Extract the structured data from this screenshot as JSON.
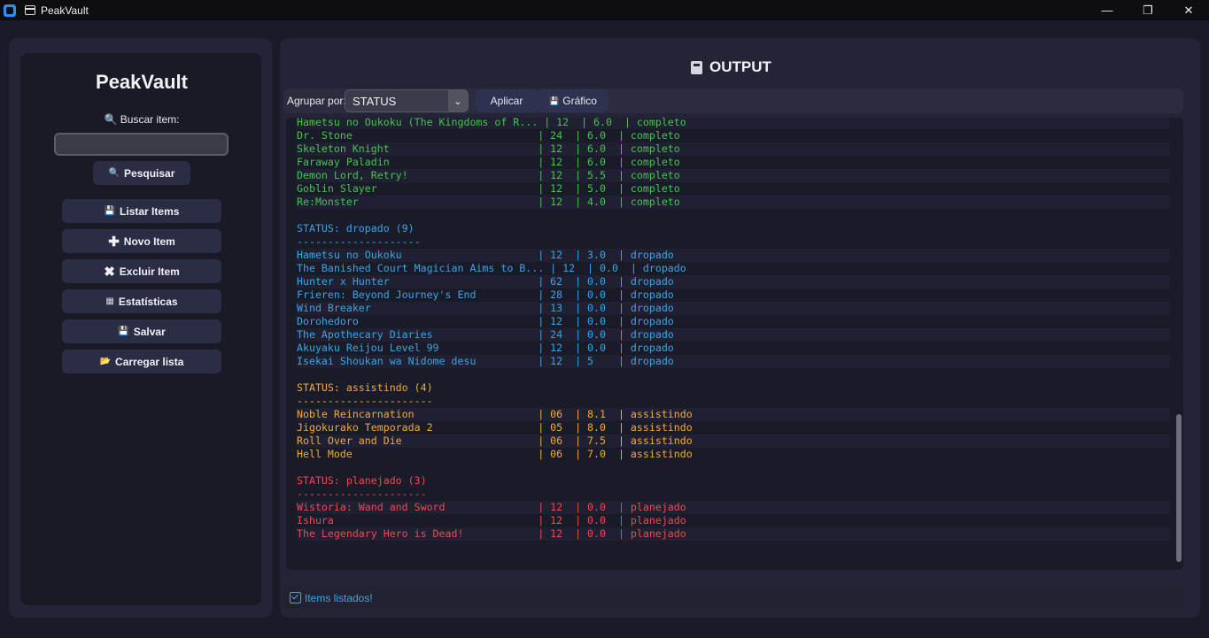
{
  "window": {
    "title": "PeakVault",
    "minimize": "—",
    "restore": "❐",
    "close": "✕"
  },
  "sidebar": {
    "app_title": "PeakVault",
    "search_label": "🔍 Buscar item:",
    "search_value": "",
    "search_button": "Pesquisar",
    "buttons": [
      {
        "icon": "💾",
        "label": "Listar Items"
      },
      {
        "icon": "✚",
        "label": "Novo Item"
      },
      {
        "icon": "✖",
        "label": "Excluir Item"
      },
      {
        "icon": "▦",
        "label": "Estatísticas"
      },
      {
        "icon": "💾",
        "label": "Salvar"
      },
      {
        "icon": "📂",
        "label": "Carregar lista"
      }
    ]
  },
  "main": {
    "title": "OUTPUT",
    "group_by_label": "Agrupar por:",
    "group_by_value": "STATUS",
    "apply_button": "Aplicar",
    "chart_button": "Gráfico",
    "status_message": "Items listados!"
  },
  "output_lines": [
    {
      "text": "Hametsu no Oukoku (The Kingdoms of R... | 12  | 6.0  | completo",
      "color": "green",
      "row": true
    },
    {
      "text": "Dr. Stone                              | 24  | 6.0  | completo",
      "color": "green",
      "row": true
    },
    {
      "text": "Skeleton Knight                        | 12  | 6.0  | completo",
      "color": "green",
      "row": true
    },
    {
      "text": "Faraway Paladin                        | 12  | 6.0  | completo",
      "color": "green",
      "row": true
    },
    {
      "text": "Demon Lord, Retry!                     | 12  | 5.5  | completo",
      "color": "green",
      "row": true
    },
    {
      "text": "Goblin Slayer                          | 12  | 5.0  | completo",
      "color": "green",
      "row": true
    },
    {
      "text": "Re:Monster                             | 12  | 4.0  | completo",
      "color": "green",
      "row": true
    },
    {
      "text": "",
      "color": "green",
      "row": false
    },
    {
      "text": "STATUS: dropado (9)",
      "color": "blue",
      "row": false
    },
    {
      "text": "--------------------",
      "color": "blue",
      "row": false
    },
    {
      "text": "Hametsu no Oukoku                      | 12  | 3.0  | dropado",
      "color": "blue",
      "row": true
    },
    {
      "text": "The Banished Court Magician Aims to B... | 12  | 0.0  | dropado",
      "color": "blue",
      "row": true
    },
    {
      "text": "Hunter x Hunter                        | 62  | 0.0  | dropado",
      "color": "blue",
      "row": true
    },
    {
      "text": "Frieren: Beyond Journey's End          | 28  | 0.0  | dropado",
      "color": "blue",
      "row": true
    },
    {
      "text": "Wind Breaker                           | 13  | 0.0  | dropado",
      "color": "blue",
      "row": true
    },
    {
      "text": "Dorohedoro                             | 12  | 0.0  | dropado",
      "color": "blue",
      "row": true
    },
    {
      "text": "The Apothecary Diaries                 | 24  | 0.0  | dropado",
      "color": "blue",
      "row": true
    },
    {
      "text": "Akuyaku Reijou Level 99                | 12  | 0.0  | dropado",
      "color": "blue",
      "row": true
    },
    {
      "text": "Isekai Shoukan wa Nidome desu          | 12  | 5    | dropado",
      "color": "blue",
      "row": true
    },
    {
      "text": "",
      "color": "blue",
      "row": false
    },
    {
      "text": "STATUS: assistindo (4)",
      "color": "orange",
      "row": false
    },
    {
      "text": "----------------------",
      "color": "orange",
      "row": false
    },
    {
      "text": "Noble Reincarnation                    | 06  | 8.1  | assistindo",
      "color": "orange",
      "row": true
    },
    {
      "text": "Jigokurako Temporada 2                 | 05  | 8.0  | assistindo",
      "color": "orange",
      "row": true
    },
    {
      "text": "Roll Over and Die                      | 06  | 7.5  | assistindo",
      "color": "orange",
      "row": true
    },
    {
      "text": "Hell Mode                              | 06  | 7.0  | assistindo",
      "color": "orange",
      "row": true
    },
    {
      "text": "",
      "color": "orange",
      "row": false
    },
    {
      "text": "STATUS: planejado (3)",
      "color": "red",
      "row": false
    },
    {
      "text": "---------------------",
      "color": "red",
      "row": false
    },
    {
      "text": "Wistoria: Wand and Sword               | 12  | 0.0  | planejado",
      "color": "red",
      "row": true
    },
    {
      "text": "Ishura                                 | 12  | 0.0  | planejado",
      "color": "red",
      "row": true
    },
    {
      "text": "The Legendary Hero is Dead!            | 12  | 0.0  | planejado",
      "color": "red",
      "row": true
    }
  ]
}
